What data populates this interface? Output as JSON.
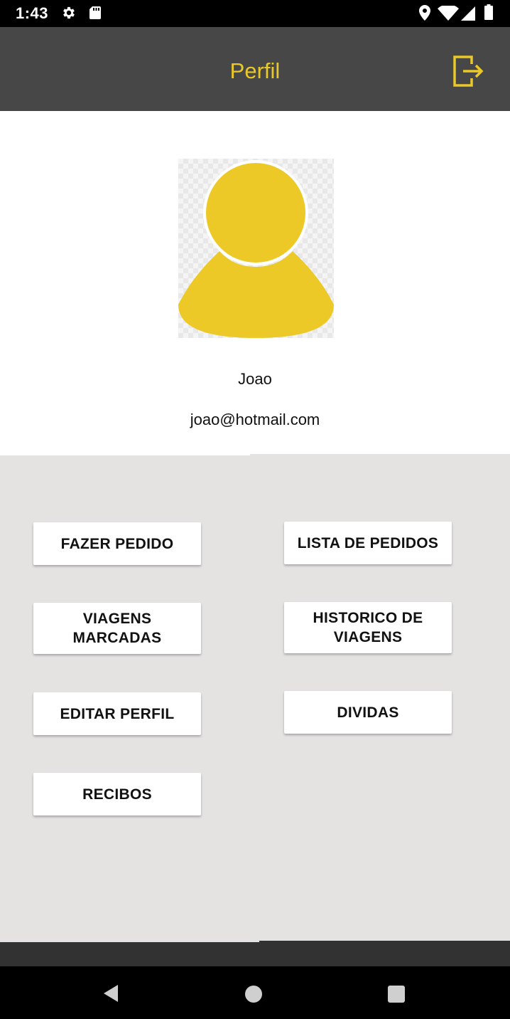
{
  "status_bar": {
    "time": "1:43",
    "icons": [
      "gear-icon",
      "sd-card-icon",
      "location-icon",
      "wifi-icon",
      "signal-icon",
      "battery-icon"
    ]
  },
  "app_bar": {
    "title": "Perfil",
    "logout_icon": "logout-icon"
  },
  "profile": {
    "avatar_icon": "person-icon",
    "name": "Joao",
    "email": "joao@hotmail.com"
  },
  "menu": {
    "fazer_pedido": "FAZER PEDIDO",
    "lista_de_pedidos": "LISTA DE PEDIDOS",
    "viagens_marcadas": "VIAGENS\nMARCADAS",
    "historico_de_viagens": "HISTORICO DE\nVIAGENS",
    "editar_perfil": "EDITAR PERFIL",
    "dividas": "DIVIDAS",
    "recibos": "RECIBOS"
  },
  "nav_bar": {
    "icons": [
      "back-icon",
      "home-icon",
      "recents-icon"
    ]
  },
  "colors": {
    "accent": "#e9c82a",
    "app_bar": "#474747",
    "menu_background": "#e4e3e2"
  }
}
